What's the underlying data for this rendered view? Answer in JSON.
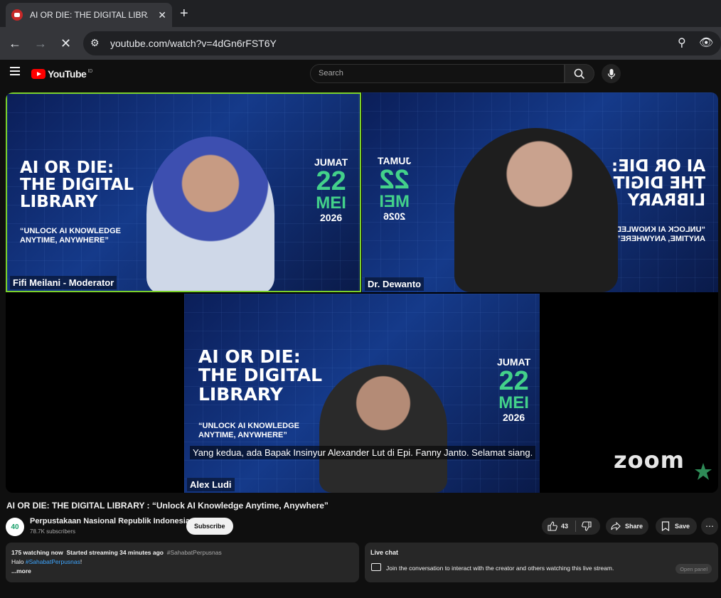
{
  "browser": {
    "tab_title": "AI OR DIE: THE DIGITAL LIBRAR…",
    "tab_close": "✕",
    "new_tab": "+",
    "url": "youtube.com/watch?v=4dGn6rFST6Y"
  },
  "youtube": {
    "logo_text": "YouTube",
    "country": "ID",
    "search_placeholder": "Search"
  },
  "video": {
    "panels": [
      {
        "name": "Fifi Meilani - Moderator",
        "headline": "AI OR DIE:\nTHE DIGITAL\nLIBRARY",
        "subline": "“UNLOCK AI KNOWLEDGE\nANYTIME, ANYWHERE”",
        "day": "JUMAT",
        "date": "22",
        "month": "MEI",
        "year": "2026"
      },
      {
        "name": "Dr. Dewanto",
        "headline": "AI OR DIE:\nTHE DIGITAL\nLIBRARY",
        "subline": "“UNLOCK AI KNOWLEDGE\nANYTIME, ANYWHERE”",
        "day": "JUMAT",
        "date": "22",
        "month": "MEI",
        "year": "2026"
      },
      {
        "name": "Alex Ludi",
        "headline": "AI OR DIE:\nTHE DIGITAL\nLIBRARY",
        "subline": "“UNLOCK AI KNOWLEDGE\nANYTIME, ANYWHERE”",
        "day": "JUMAT",
        "date": "22",
        "month": "MEI",
        "year": "2026"
      }
    ],
    "caption": "Yang kedua, ada Bapak Insinyur Alexander Lut di Epi. Fanny Janto. Selamat siang.",
    "watermark": "zoom"
  },
  "meta": {
    "title": "AI OR DIE: THE DIGITAL LIBRARY : “Unlock AI Knowledge Anytime, Anywhere”",
    "channel_name": "Perpustakaan Nasional Republik Indonesia",
    "subscribers": "78.7K subscribers",
    "subscribe_label": "Subscribe",
    "likes": "43",
    "share_label": "Share",
    "save_label": "Save"
  },
  "description": {
    "watching": "175 watching now",
    "started": "Started streaming 34 minutes ago",
    "hashtag": "#SahabatPerpusnas",
    "line2_prefix": "Halo",
    "line2_tag": "#SahabatPerpusnas",
    "line2_suffix": "!",
    "more": "...more"
  },
  "chat": {
    "title": "Live chat",
    "message": "Join the conversation to interact with the creator and others watching this live stream.",
    "open_label": "Open panel"
  }
}
